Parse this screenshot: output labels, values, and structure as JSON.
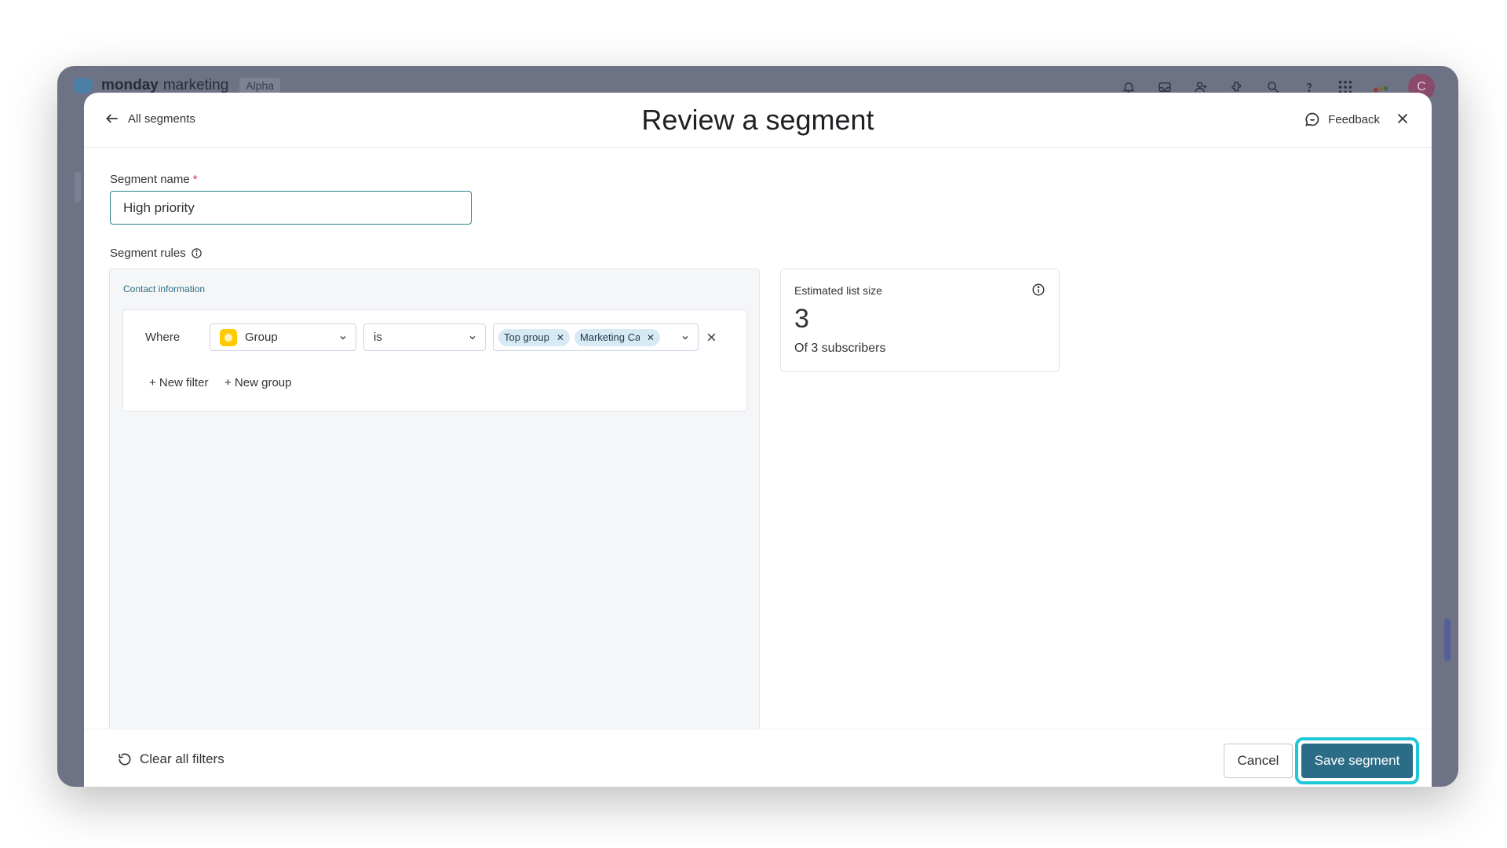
{
  "app": {
    "brand_bold": "monday",
    "brand_rest": "marketing",
    "tag": "Alpha",
    "avatar_initial": "C",
    "topbar_icons": [
      "bell-icon",
      "inbox-icon",
      "invite-user-icon",
      "integrations-icon",
      "search-icon",
      "help-icon",
      "apps-grid-icon",
      "monday-logo-icon"
    ]
  },
  "modal": {
    "back_label": "All segments",
    "title": "Review a segment",
    "feedback_label": "Feedback"
  },
  "segment_name": {
    "label": "Segment name",
    "required_mark": "*",
    "value": "High priority"
  },
  "segment_rules": {
    "label": "Segment rules",
    "section_title": "Contact information",
    "filter": {
      "where_label": "Where",
      "column": "Group",
      "operator": "is",
      "values": [
        "Top group",
        "Marketing Ca"
      ]
    },
    "new_filter_label": "+ New filter",
    "new_group_label": "+ New group"
  },
  "estimate": {
    "title": "Estimated list size",
    "count": "3",
    "subtitle": "Of 3 subscribers"
  },
  "footer": {
    "clear_label": "Clear all filters",
    "cancel_label": "Cancel",
    "save_label": "Save segment"
  },
  "colors": {
    "accent": "#2b6c87",
    "highlight": "#1fc8d6",
    "group_color": "#ffcb00",
    "chip_bg": "#d7e9f3"
  }
}
